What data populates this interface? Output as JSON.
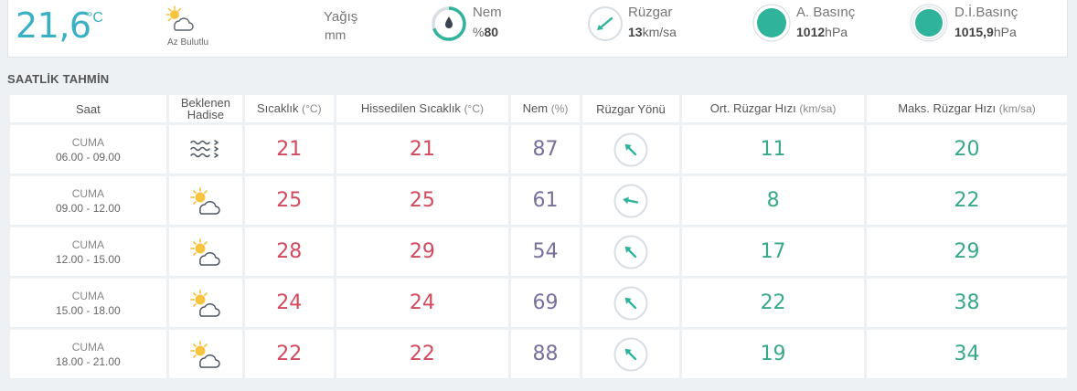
{
  "current": {
    "temperature": "21,6",
    "temperature_unit": "°C",
    "condition_icon": "partly-cloudy-icon",
    "condition": "Az Bulutlu",
    "precipitation_label": "Yağış",
    "precipitation_unit": "mm",
    "humidity_label": "Nem",
    "humidity_prefix": "%",
    "humidity_value": "80",
    "wind_label": "Rüzgar",
    "wind_value": "13",
    "wind_unit": "km/sa",
    "pressure_label": "A. Basınç",
    "pressure_value": "1012",
    "pressure_unit": "hPa",
    "sea_pressure_label": "D.İ.Basınç",
    "sea_pressure_value": "1015,9",
    "sea_pressure_unit": "hPa"
  },
  "section_title": "SAATLİK TAHMİN",
  "columns": {
    "time": "Saat",
    "event_line1": "Beklenen",
    "event_line2": "Hadise",
    "temp": "Sıcaklık",
    "temp_unit": "(°C)",
    "feels": "Hissedilen Sıcaklık",
    "feels_unit": "(°C)",
    "humidity": "Nem",
    "humidity_unit": "(%)",
    "wind_dir": "Rüzgar Yönü",
    "avg_wind": "Ort. Rüzgar Hızı",
    "avg_wind_unit": "(km/sa)",
    "max_wind": "Maks. Rüzgar Hızı",
    "max_wind_unit": "(km/sa)"
  },
  "rows": [
    {
      "day": "CUMA",
      "time": "06.00 - 09.00",
      "icon": "fog-icon",
      "temp": "21",
      "feels": "21",
      "humidity": "87",
      "wind_dir_icon": "arrow-southwest-icon",
      "avg_wind": "11",
      "max_wind": "20"
    },
    {
      "day": "CUMA",
      "time": "09.00 - 12.00",
      "icon": "partly-cloudy-icon",
      "temp": "25",
      "feels": "25",
      "humidity": "61",
      "wind_dir_icon": "arrow-west-icon",
      "avg_wind": "8",
      "max_wind": "22"
    },
    {
      "day": "CUMA",
      "time": "12.00 - 15.00",
      "icon": "partly-cloudy-icon",
      "temp": "28",
      "feels": "29",
      "humidity": "54",
      "wind_dir_icon": "arrow-southwest-icon",
      "avg_wind": "17",
      "max_wind": "29"
    },
    {
      "day": "CUMA",
      "time": "15.00 - 18.00",
      "icon": "partly-cloudy-icon",
      "temp": "24",
      "feels": "24",
      "humidity": "69",
      "wind_dir_icon": "arrow-southwest-icon",
      "avg_wind": "22",
      "max_wind": "38"
    },
    {
      "day": "CUMA",
      "time": "18.00 - 21.00",
      "icon": "partly-cloudy-icon",
      "temp": "22",
      "feels": "22",
      "humidity": "88",
      "wind_dir_icon": "arrow-southwest-icon",
      "avg_wind": "19",
      "max_wind": "34"
    }
  ],
  "colors": {
    "accent": "#3ab0c4",
    "temperature": "#d24a5e",
    "humidity": "#7a6f9a",
    "wind": "#38a88a",
    "pressure_fill": "#2fb39a"
  }
}
